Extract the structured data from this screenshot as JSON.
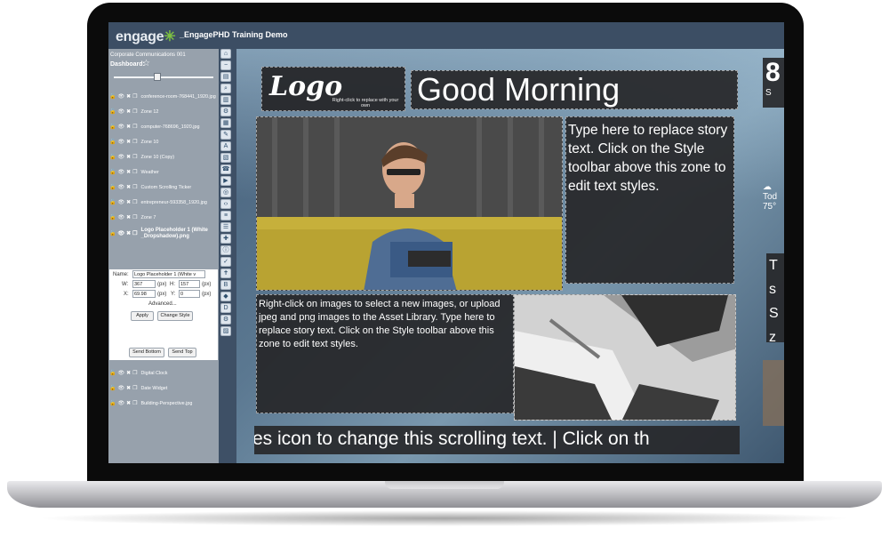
{
  "app": {
    "brand": "engage",
    "brand_mark": "✳",
    "project": "_EngagePHD Training Demo"
  },
  "sidebar": {
    "org": "Corporate Communications 001",
    "dashboard": "Dashboard:",
    "layers_top": [
      "conference-room-768441_1920.jpg",
      "Zone 12",
      "computer-768696_1920.jpg",
      "Zone 10",
      "Zone 10 (Copy)",
      "Weather",
      "Custom Scrolling Ticker",
      "entrepreneur-593358_1920.jpg",
      "Zone 7"
    ],
    "selected_layer_line1": "Logo Placeholder 1 (White",
    "selected_layer_line2": "_Dropshadow).png",
    "props": {
      "name_label": "Name:",
      "name_value": "Logo Placeholder 1 (White v",
      "w_label": "W:",
      "w_value": "367",
      "h_label": "H:",
      "h_value": "157",
      "x_label": "X:",
      "x_value": "69.98",
      "y_label": "Y:",
      "y_value": "0",
      "unit": "(px)",
      "advanced": "Advanced...",
      "apply": "Apply",
      "change_style": "Change Style"
    },
    "send_bottom": "Send Bottom",
    "send_top": "Send Top",
    "layers_bottom": [
      "Digital Clock",
      "Date Widget",
      "Building-Perspective.jpg"
    ]
  },
  "toolbar": {
    "buttons": [
      "⌂",
      "−",
      "▤",
      "⌕",
      "▥",
      "⚙",
      "▦",
      "✎",
      "A",
      "▧",
      "☎",
      "▶",
      "◎",
      "‹›",
      "≡",
      "☰",
      "✚",
      "ⓘ",
      "✓",
      "✝",
      "B",
      "◆",
      "D",
      "⚙",
      "▨"
    ]
  },
  "canvas": {
    "logo": "Logo",
    "logo_sub": "Right-click to replace with your own",
    "greeting": "Good Morning",
    "story1": "Type here to replace story text. Click on the Style toolbar above this zone to edit text styles.",
    "story2": "Right-click on images to select a new images, or upload jpeg and png images to the Asset Library. Type here to replace story text. Click on the Style toolbar above this zone to edit text styles.",
    "ticker": "es icon to change this scrolling text. | Click on th",
    "clock_partial": "8",
    "clock_sub": "S",
    "weather_day": "Tod",
    "weather_temp": "75°",
    "right_story": "T s S z"
  },
  "colors": {
    "app_bar": "#3c4e64",
    "panel": "#97a1ac",
    "accent_green": "#7ec242",
    "zone_dark": "#262628"
  }
}
